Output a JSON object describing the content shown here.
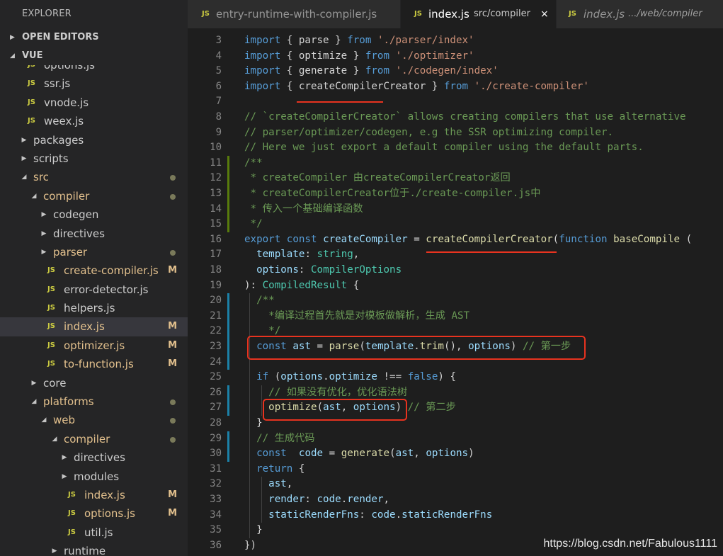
{
  "explorer": {
    "title": "EXPLORER",
    "open_editors_label": "OPEN EDITORS",
    "project_label": "VUE"
  },
  "tree": [
    {
      "label": "options.js",
      "kind": "file",
      "indent": 0,
      "badge": "",
      "dot": ""
    },
    {
      "label": "ssr.js",
      "kind": "file",
      "indent": 0,
      "badge": "",
      "dot": ""
    },
    {
      "label": "vnode.js",
      "kind": "file",
      "indent": 0,
      "badge": "",
      "dot": ""
    },
    {
      "label": "weex.js",
      "kind": "file",
      "indent": 0,
      "badge": "",
      "dot": ""
    },
    {
      "label": "packages",
      "kind": "folder-closed",
      "indent": 0,
      "badge": "",
      "dot": ""
    },
    {
      "label": "scripts",
      "kind": "folder-closed",
      "indent": 0,
      "badge": "",
      "dot": ""
    },
    {
      "label": "src",
      "kind": "folder-open",
      "indent": 0,
      "badge": "",
      "dot": "#7a7a5a",
      "modified": true
    },
    {
      "label": "compiler",
      "kind": "folder-open",
      "indent": 1,
      "badge": "",
      "dot": "#7a7a5a",
      "modified": true
    },
    {
      "label": "codegen",
      "kind": "folder-closed",
      "indent": 2,
      "badge": "",
      "dot": ""
    },
    {
      "label": "directives",
      "kind": "folder-closed",
      "indent": 2,
      "badge": "",
      "dot": ""
    },
    {
      "label": "parser",
      "kind": "folder-closed",
      "indent": 2,
      "badge": "",
      "dot": "#7a7a5a",
      "modified": true
    },
    {
      "label": "create-compiler.js",
      "kind": "file",
      "indent": 2,
      "badge": "M",
      "dot": "",
      "modified": true
    },
    {
      "label": "error-detector.js",
      "kind": "file",
      "indent": 2,
      "badge": "",
      "dot": ""
    },
    {
      "label": "helpers.js",
      "kind": "file",
      "indent": 2,
      "badge": "",
      "dot": ""
    },
    {
      "label": "index.js",
      "kind": "file",
      "indent": 2,
      "badge": "M",
      "dot": "",
      "modified": true,
      "selected": true
    },
    {
      "label": "optimizer.js",
      "kind": "file",
      "indent": 2,
      "badge": "M",
      "dot": "",
      "modified": true
    },
    {
      "label": "to-function.js",
      "kind": "file",
      "indent": 2,
      "badge": "M",
      "dot": "",
      "modified": true
    },
    {
      "label": "core",
      "kind": "folder-closed",
      "indent": 1,
      "badge": "",
      "dot": ""
    },
    {
      "label": "platforms",
      "kind": "folder-open",
      "indent": 1,
      "badge": "",
      "dot": "#7a7a5a",
      "modified": true
    },
    {
      "label": "web",
      "kind": "folder-open",
      "indent": 2,
      "badge": "",
      "dot": "#7a7a5a",
      "modified": true
    },
    {
      "label": "compiler",
      "kind": "folder-open",
      "indent": 3,
      "badge": "",
      "dot": "#7a7a5a",
      "modified": true
    },
    {
      "label": "directives",
      "kind": "folder-closed",
      "indent": 4,
      "badge": "",
      "dot": ""
    },
    {
      "label": "modules",
      "kind": "folder-closed",
      "indent": 4,
      "badge": "",
      "dot": ""
    },
    {
      "label": "index.js",
      "kind": "file",
      "indent": 4,
      "badge": "M",
      "dot": "",
      "modified": true
    },
    {
      "label": "options.js",
      "kind": "file",
      "indent": 4,
      "badge": "M",
      "dot": "",
      "modified": true
    },
    {
      "label": "util.js",
      "kind": "file",
      "indent": 4,
      "badge": "",
      "dot": ""
    },
    {
      "label": "runtime",
      "kind": "folder-closed",
      "indent": 3,
      "badge": "",
      "dot": ""
    }
  ],
  "tabs": [
    {
      "icon": "JS",
      "name": "entry-runtime-with-compiler.js",
      "path": "",
      "active": false
    },
    {
      "icon": "JS",
      "name": "index.js",
      "path": "src/compiler",
      "active": true,
      "close": "×"
    },
    {
      "icon": "JS",
      "name": "index.js",
      "path": ".../web/compiler",
      "active": false
    }
  ],
  "code": [
    {
      "n": "3",
      "indent": 0,
      "tokens": [
        [
          "k",
          "import"
        ],
        [
          "p",
          " { parse } "
        ],
        [
          "k",
          "from"
        ],
        [
          "p",
          " "
        ],
        [
          "s",
          "'./parser/index'"
        ]
      ]
    },
    {
      "n": "4",
      "indent": 0,
      "tokens": [
        [
          "k",
          "import"
        ],
        [
          "p",
          " { optimize } "
        ],
        [
          "k",
          "from"
        ],
        [
          "p",
          " "
        ],
        [
          "s",
          "'./optimizer'"
        ]
      ]
    },
    {
      "n": "5",
      "indent": 0,
      "tokens": [
        [
          "k",
          "import"
        ],
        [
          "p",
          " { generate } "
        ],
        [
          "k",
          "from"
        ],
        [
          "p",
          " "
        ],
        [
          "s",
          "'./codegen/index'"
        ]
      ]
    },
    {
      "n": "6",
      "indent": 0,
      "tokens": [
        [
          "k",
          "import"
        ],
        [
          "p",
          " { createCompilerCreator } "
        ],
        [
          "k",
          "from"
        ],
        [
          "p",
          " "
        ],
        [
          "s",
          "'./create-compiler'"
        ]
      ]
    },
    {
      "n": "7",
      "indent": 0,
      "tokens": []
    },
    {
      "n": "8",
      "indent": 0,
      "tokens": [
        [
          "c",
          "// `createCompilerCreator` allows creating compilers that use alternative"
        ]
      ]
    },
    {
      "n": "9",
      "indent": 0,
      "tokens": [
        [
          "c",
          "// parser/optimizer/codegen, e.g the SSR optimizing compiler."
        ]
      ]
    },
    {
      "n": "10",
      "indent": 0,
      "tokens": [
        [
          "c",
          "// Here we just export a default compiler using the default parts."
        ]
      ]
    },
    {
      "n": "11",
      "indent": 0,
      "tokens": [
        [
          "c",
          "/**"
        ]
      ]
    },
    {
      "n": "12",
      "indent": 0,
      "tokens": [
        [
          "c",
          " * createCompiler 由createCompilerCreator返回"
        ]
      ]
    },
    {
      "n": "13",
      "indent": 0,
      "tokens": [
        [
          "c",
          " * createCompilerCreator位于./create-compiler.js中"
        ]
      ]
    },
    {
      "n": "14",
      "indent": 0,
      "tokens": [
        [
          "c",
          " * 传入一个基础编译函数"
        ]
      ]
    },
    {
      "n": "15",
      "indent": 0,
      "tokens": [
        [
          "c",
          " */"
        ]
      ]
    },
    {
      "n": "16",
      "indent": 0,
      "tokens": [
        [
          "k",
          "export"
        ],
        [
          "p",
          " "
        ],
        [
          "k",
          "const"
        ],
        [
          "p",
          " "
        ],
        [
          "v",
          "createCompiler"
        ],
        [
          "p",
          " = "
        ],
        [
          "f",
          "createCompilerCreator"
        ],
        [
          "p",
          "("
        ],
        [
          "k",
          "function"
        ],
        [
          "p",
          " "
        ],
        [
          "f",
          "baseCompile"
        ],
        [
          "p",
          " ("
        ]
      ]
    },
    {
      "n": "17",
      "indent": 0,
      "tokens": [
        [
          "p",
          "  "
        ],
        [
          "v",
          "template"
        ],
        [
          "p",
          ": "
        ],
        [
          "t",
          "string"
        ],
        [
          "p",
          ","
        ]
      ]
    },
    {
      "n": "18",
      "indent": 0,
      "tokens": [
        [
          "p",
          "  "
        ],
        [
          "v",
          "options"
        ],
        [
          "p",
          ": "
        ],
        [
          "t",
          "CompilerOptions"
        ]
      ]
    },
    {
      "n": "19",
      "indent": 0,
      "tokens": [
        [
          "p",
          "): "
        ],
        [
          "t",
          "CompiledResult"
        ],
        [
          "p",
          " {"
        ]
      ]
    },
    {
      "n": "20",
      "indent": 0,
      "tokens": [
        [
          "p",
          "  "
        ],
        [
          "c",
          "/**"
        ]
      ]
    },
    {
      "n": "21",
      "indent": 0,
      "tokens": [
        [
          "p",
          "  "
        ],
        [
          "c",
          "  *编译过程首先就是对模板做解析，生成 AST"
        ]
      ]
    },
    {
      "n": "22",
      "indent": 0,
      "tokens": [
        [
          "p",
          "  "
        ],
        [
          "c",
          "  */"
        ]
      ]
    },
    {
      "n": "23",
      "indent": 0,
      "tokens": [
        [
          "p",
          "  "
        ],
        [
          "k",
          "const"
        ],
        [
          "p",
          " "
        ],
        [
          "v",
          "ast"
        ],
        [
          "p",
          " = "
        ],
        [
          "f",
          "parse"
        ],
        [
          "p",
          "("
        ],
        [
          "v",
          "template"
        ],
        [
          "p",
          "."
        ],
        [
          "f",
          "trim"
        ],
        [
          "p",
          "(), "
        ],
        [
          "v",
          "options"
        ],
        [
          "p",
          ") "
        ],
        [
          "c",
          "// 第一步"
        ]
      ]
    },
    {
      "n": "24",
      "indent": 0,
      "tokens": []
    },
    {
      "n": "25",
      "indent": 0,
      "tokens": [
        [
          "p",
          "  "
        ],
        [
          "k",
          "if"
        ],
        [
          "p",
          " ("
        ],
        [
          "v",
          "options"
        ],
        [
          "p",
          "."
        ],
        [
          "v",
          "optimize"
        ],
        [
          "p",
          " !== "
        ],
        [
          "k",
          "false"
        ],
        [
          "p",
          ") {"
        ]
      ]
    },
    {
      "n": "26",
      "indent": 0,
      "tokens": [
        [
          "p",
          "    "
        ],
        [
          "c",
          "// 如果没有优化，优化语法树"
        ]
      ]
    },
    {
      "n": "27",
      "indent": 0,
      "tokens": [
        [
          "p",
          "    "
        ],
        [
          "f",
          "optimize"
        ],
        [
          "p",
          "("
        ],
        [
          "v",
          "ast"
        ],
        [
          "p",
          ", "
        ],
        [
          "v",
          "options"
        ],
        [
          "p",
          ") "
        ],
        [
          "c",
          "// 第二步"
        ]
      ]
    },
    {
      "n": "28",
      "indent": 0,
      "tokens": [
        [
          "p",
          "  }"
        ]
      ]
    },
    {
      "n": "29",
      "indent": 0,
      "tokens": [
        [
          "p",
          "  "
        ],
        [
          "c",
          "// 生成代码"
        ]
      ]
    },
    {
      "n": "30",
      "indent": 0,
      "tokens": [
        [
          "p",
          "  "
        ],
        [
          "k",
          "const"
        ],
        [
          "p",
          "  "
        ],
        [
          "v",
          "code"
        ],
        [
          "p",
          " = "
        ],
        [
          "f",
          "generate"
        ],
        [
          "p",
          "("
        ],
        [
          "v",
          "ast"
        ],
        [
          "p",
          ", "
        ],
        [
          "v",
          "options"
        ],
        [
          "p",
          ")"
        ]
      ]
    },
    {
      "n": "31",
      "indent": 0,
      "tokens": [
        [
          "p",
          "  "
        ],
        [
          "k",
          "return"
        ],
        [
          "p",
          " {"
        ]
      ]
    },
    {
      "n": "32",
      "indent": 0,
      "tokens": [
        [
          "p",
          "    "
        ],
        [
          "v",
          "ast"
        ],
        [
          "p",
          ","
        ]
      ]
    },
    {
      "n": "33",
      "indent": 0,
      "tokens": [
        [
          "p",
          "    "
        ],
        [
          "v",
          "render"
        ],
        [
          "p",
          ": "
        ],
        [
          "v",
          "code"
        ],
        [
          "p",
          "."
        ],
        [
          "v",
          "render"
        ],
        [
          "p",
          ","
        ]
      ]
    },
    {
      "n": "34",
      "indent": 0,
      "tokens": [
        [
          "p",
          "    "
        ],
        [
          "v",
          "staticRenderFns"
        ],
        [
          "p",
          ": "
        ],
        [
          "v",
          "code"
        ],
        [
          "p",
          "."
        ],
        [
          "v",
          "staticRenderFns"
        ]
      ]
    },
    {
      "n": "35",
      "indent": 0,
      "tokens": [
        [
          "p",
          "  }"
        ]
      ]
    },
    {
      "n": "36",
      "indent": 0,
      "tokens": [
        [
          "p",
          "})"
        ]
      ]
    }
  ],
  "colors": {
    "modified_text": "#e2c08d",
    "modified_dot": "#7a7a5a",
    "added_bar": "#587c0c",
    "modified_bar": "#1b81a8",
    "annotation_red": "#e8331f"
  },
  "watermark": "https://blog.csdn.net/Fabulous1111"
}
